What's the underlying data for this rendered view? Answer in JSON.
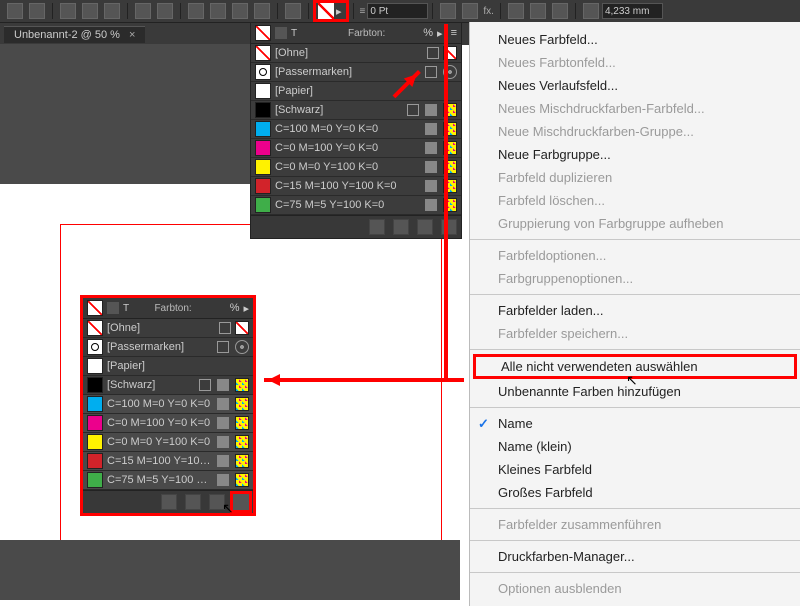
{
  "appbar": {
    "stroke_value": "0 Pt",
    "dim_value": "4,233 mm"
  },
  "document": {
    "tab": "Unbenannt-2 @ 50 %"
  },
  "panel": {
    "farbton_label": "Farbton:",
    "percent": "%",
    "swatches": [
      {
        "name": "[Ohne]",
        "type": "none"
      },
      {
        "name": "[Passermarken]",
        "type": "reg"
      },
      {
        "name": "[Papier]",
        "type": "pap"
      },
      {
        "name": "[Schwarz]",
        "type": "blk"
      },
      {
        "name": "C=100 M=0 Y=0 K=0",
        "type": "c",
        "color": "#00AEEF"
      },
      {
        "name": "C=0 M=100 Y=0 K=0",
        "type": "c",
        "color": "#EC008C"
      },
      {
        "name": "C=0 M=0 Y=100 K=0",
        "type": "c",
        "color": "#FFF200"
      },
      {
        "name": "C=15 M=100 Y=100 K=0",
        "type": "c",
        "color": "#D2232A"
      },
      {
        "name": "C=75 M=5 Y=100 K=0",
        "type": "c",
        "color": "#3FAE49"
      }
    ],
    "short_red": "C=15 M=100 Y=100 ..."
  },
  "menu": {
    "items": [
      {
        "label": "Neues Farbfeld...",
        "disabled": false
      },
      {
        "label": "Neues Farbtonfeld...",
        "disabled": true
      },
      {
        "label": "Neues Verlaufsfeld...",
        "disabled": false
      },
      {
        "label": "Neues Mischdruckfarben-Farbfeld...",
        "disabled": true
      },
      {
        "label": "Neue Mischdruckfarben-Gruppe...",
        "disabled": true
      },
      {
        "label": "Neue Farbgruppe...",
        "disabled": false
      },
      {
        "label": "Farbfeld duplizieren",
        "disabled": true
      },
      {
        "label": "Farbfeld löschen...",
        "disabled": true
      },
      {
        "label": "Gruppierung von Farbgruppe aufheben",
        "disabled": true
      },
      {
        "divider": true
      },
      {
        "label": "Farbfeldoptionen...",
        "disabled": true
      },
      {
        "label": "Farbgruppenoptionen...",
        "disabled": true
      },
      {
        "divider": true
      },
      {
        "label": "Farbfelder laden...",
        "disabled": false
      },
      {
        "label": "Farbfelder speichern...",
        "disabled": true
      },
      {
        "divider": true
      },
      {
        "label": "Alle nicht verwendeten auswählen",
        "disabled": false,
        "highlighted": true
      },
      {
        "label": "Unbenannte Farben hinzufügen",
        "disabled": false
      },
      {
        "divider": true
      },
      {
        "label": "Name",
        "disabled": false,
        "checked": true
      },
      {
        "label": "Name (klein)",
        "disabled": false
      },
      {
        "label": "Kleines Farbfeld",
        "disabled": false
      },
      {
        "label": "Großes Farbfeld",
        "disabled": false
      },
      {
        "divider": true
      },
      {
        "label": "Farbfelder zusammenführen",
        "disabled": true
      },
      {
        "divider": true
      },
      {
        "label": "Druckfarben-Manager...",
        "disabled": false
      },
      {
        "divider": true
      },
      {
        "label": "Optionen ausblenden",
        "disabled": true
      }
    ]
  }
}
